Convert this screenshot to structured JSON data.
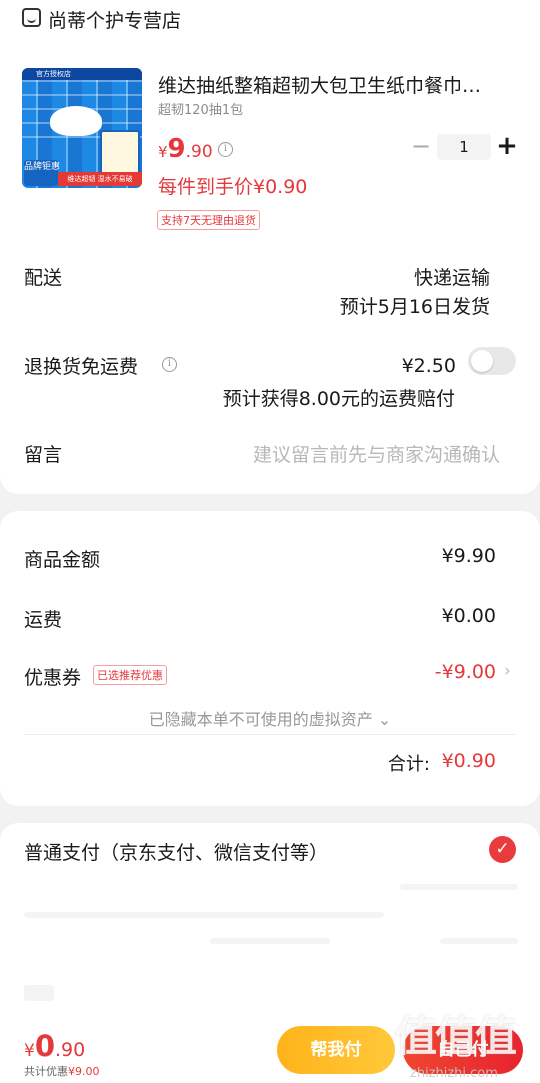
{
  "store": {
    "name": "尚蒂个护专营店",
    "icon": "store-icon"
  },
  "product": {
    "title": "维达抽纸整箱超韧大包卫生纸巾餐巾…",
    "spec": "超韧120抽1包",
    "price_currency": "¥",
    "price_int": "9",
    "price_dec": ".90",
    "promo": "每件到手价¥0.90",
    "return_tag": "支持7天无理由退货",
    "quantity": "1",
    "thumb": {
      "store_tag": "官方授权店",
      "badge": "品牌钜惠",
      "banner": "维达超韧 湿水不易破"
    }
  },
  "delivery": {
    "label": "配送",
    "method": "快递运输",
    "eta": "预计5月16日发货"
  },
  "return_shipping": {
    "label": "退换货免运费",
    "price": "¥2.50",
    "note": "预计获得8.00元的运费赔付",
    "enabled": false
  },
  "message": {
    "label": "留言",
    "placeholder": "建议留言前先与商家沟通确认"
  },
  "summary": {
    "goods_label": "商品金额",
    "goods_value": "¥9.90",
    "freight_label": "运费",
    "freight_value": "¥0.00",
    "coupon_label": "优惠券",
    "coupon_tag": "已选推荐优惠",
    "coupon_value": "-¥9.00",
    "hidden_assets": "已隐藏本单不可使用的虚拟资产",
    "total_label": "合计:",
    "total_value": "¥0.90"
  },
  "payment": {
    "label": "普通支付（京东支付、微信支付等）",
    "selected": true
  },
  "bottom": {
    "price_currency": "¥",
    "price_int": "0",
    "price_dec": ".90",
    "discount_label": "共计优惠",
    "discount_value": "¥9.00",
    "help_pay": "帮我付",
    "pay": "自己付"
  },
  "watermark": {
    "text": "值值值",
    "url": "zhizhizhi.com"
  },
  "colors": {
    "accent": "#e4393c",
    "help_button": "#ffb31a",
    "pay_button": "#e8232f"
  }
}
